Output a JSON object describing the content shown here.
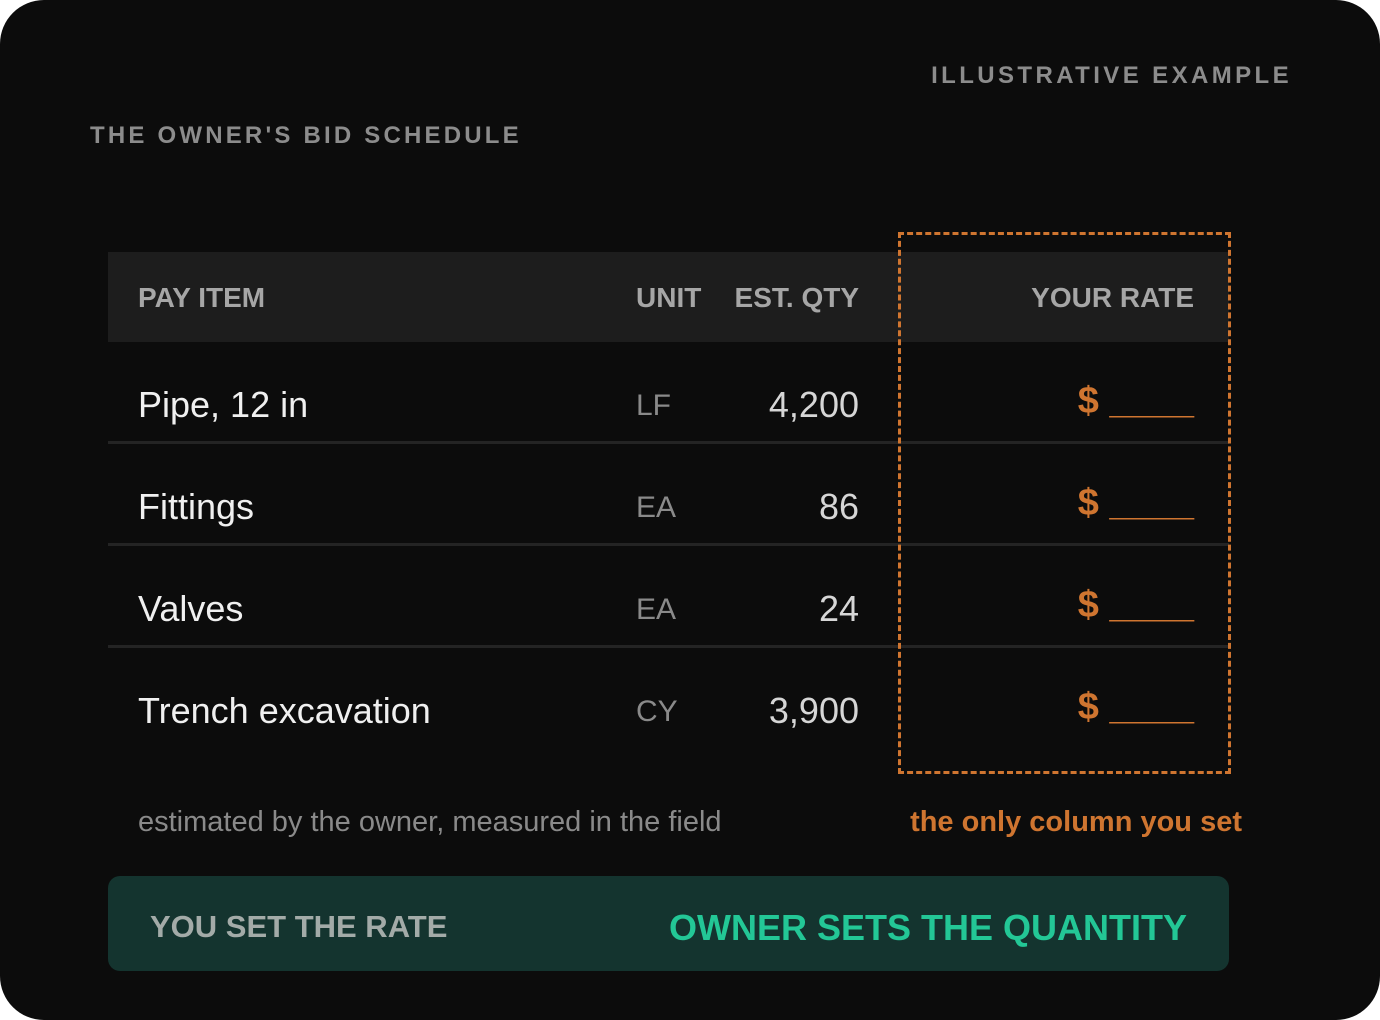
{
  "header": {
    "badge": "ILLUSTRATIVE EXAMPLE",
    "title": "THE OWNER'S BID SCHEDULE"
  },
  "table": {
    "columns": {
      "item": "PAY ITEM",
      "unit": "UNIT",
      "qty": "EST. QTY",
      "rate": "YOUR RATE"
    },
    "rows": [
      {
        "item": "Pipe, 12 in",
        "unit": "LF",
        "qty": "4,200",
        "rate": "$ ____"
      },
      {
        "item": "Fittings",
        "unit": "EA",
        "qty": "86",
        "rate": "$ ____"
      },
      {
        "item": "Valves",
        "unit": "EA",
        "qty": "24",
        "rate": "$ ____"
      },
      {
        "item": "Trench excavation",
        "unit": "CY",
        "qty": "3,900",
        "rate": "$ ____"
      }
    ]
  },
  "notes": {
    "left": "estimated by the owner, measured in the field",
    "right": "the only column you set"
  },
  "banner": {
    "left": "YOU SET THE RATE",
    "right": "OWNER SETS THE QUANTITY"
  },
  "colors": {
    "background": "#0c0c0c",
    "accent_orange": "#cf7530",
    "accent_green": "#23c796",
    "banner_bg": "#14342f"
  }
}
